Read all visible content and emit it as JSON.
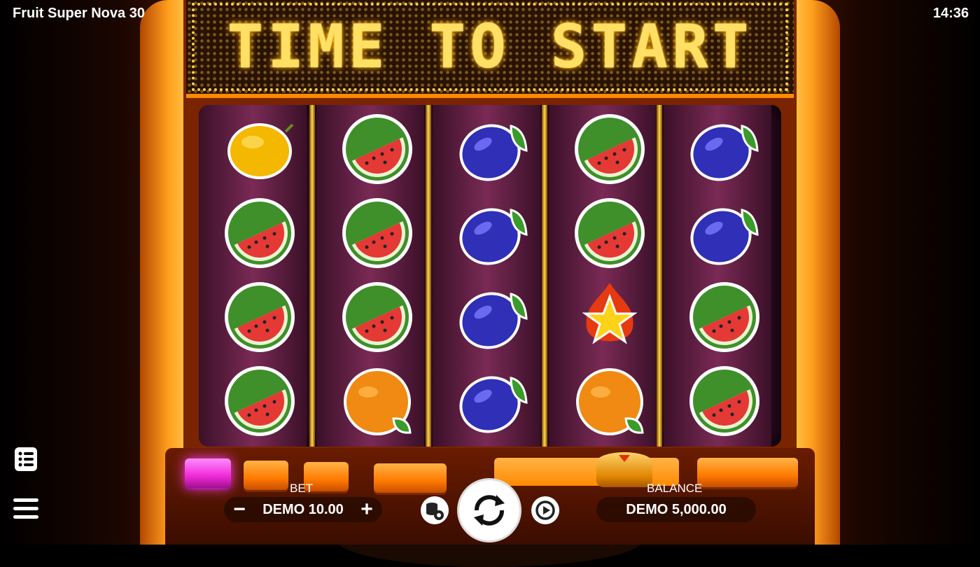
{
  "header": {
    "title": "Fruit Super Nova 30",
    "time": "14:36"
  },
  "marquee": {
    "text": "TIME TO START"
  },
  "reels": [
    [
      "lemon",
      "watermelon",
      "watermelon",
      "watermelon"
    ],
    [
      "watermelon",
      "watermelon",
      "watermelon",
      "orange"
    ],
    [
      "plum",
      "plum",
      "plum",
      "plum"
    ],
    [
      "watermelon",
      "watermelon",
      "star",
      "orange"
    ],
    [
      "plum",
      "plum",
      "watermelon",
      "watermelon"
    ]
  ],
  "controls": {
    "bet_label": "BET",
    "bet_value": "DEMO 10.00",
    "balance_label": "BALANCE",
    "balance_value": "DEMO 5,000.00",
    "minus": "−",
    "plus": "+"
  },
  "icons": {
    "paytable": "paytable-icon",
    "menu": "menu-icon",
    "bet_settings": "coins-gear-icon",
    "spin": "spin-arrows-icon",
    "autoplay": "autoplay-icon"
  },
  "colors": {
    "accent": "#ff8a00",
    "marquee_text": "#ffe065",
    "reel_bg": "#7a2a55",
    "highlight_button": "#f02ad8"
  }
}
